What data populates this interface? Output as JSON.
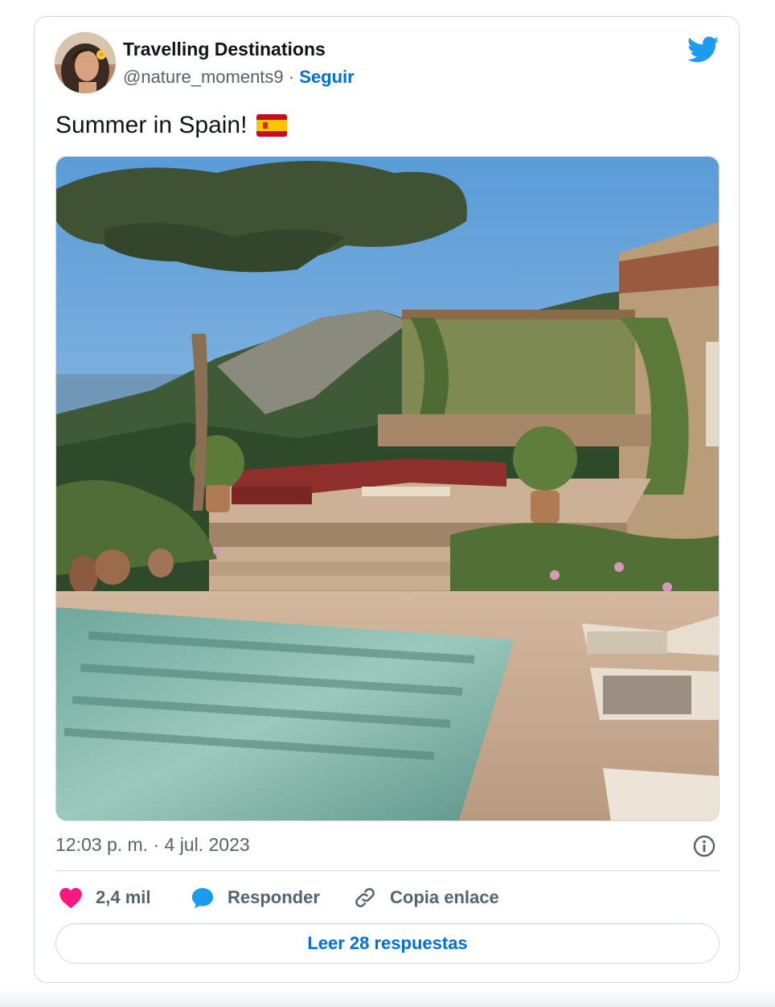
{
  "author": {
    "name": "Travelling Destinations",
    "handle": "@nature_moments9",
    "separator": " · ",
    "follow_label": "Seguir"
  },
  "tweet": {
    "text": "Summer in Spain!",
    "flag_emoji": "spain-flag-icon",
    "media": "villa-pool-photo"
  },
  "meta": {
    "timestamp": "12:03 p. m. · 4 jul. 2023"
  },
  "actions": {
    "likes": "2,4 mil",
    "reply_label": "Responder",
    "copy_label": "Copia enlace",
    "read_replies": "Leer 28 respuestas"
  },
  "colors": {
    "brand_blue": "#1d9bf0",
    "link_blue": "#006fd6",
    "like_pink": "#f91880",
    "muted_text": "#536471",
    "border": "#cfd9de"
  },
  "icons": [
    "twitter-bird-icon",
    "info-icon",
    "heart-icon",
    "reply-bubble-icon",
    "link-icon"
  ]
}
